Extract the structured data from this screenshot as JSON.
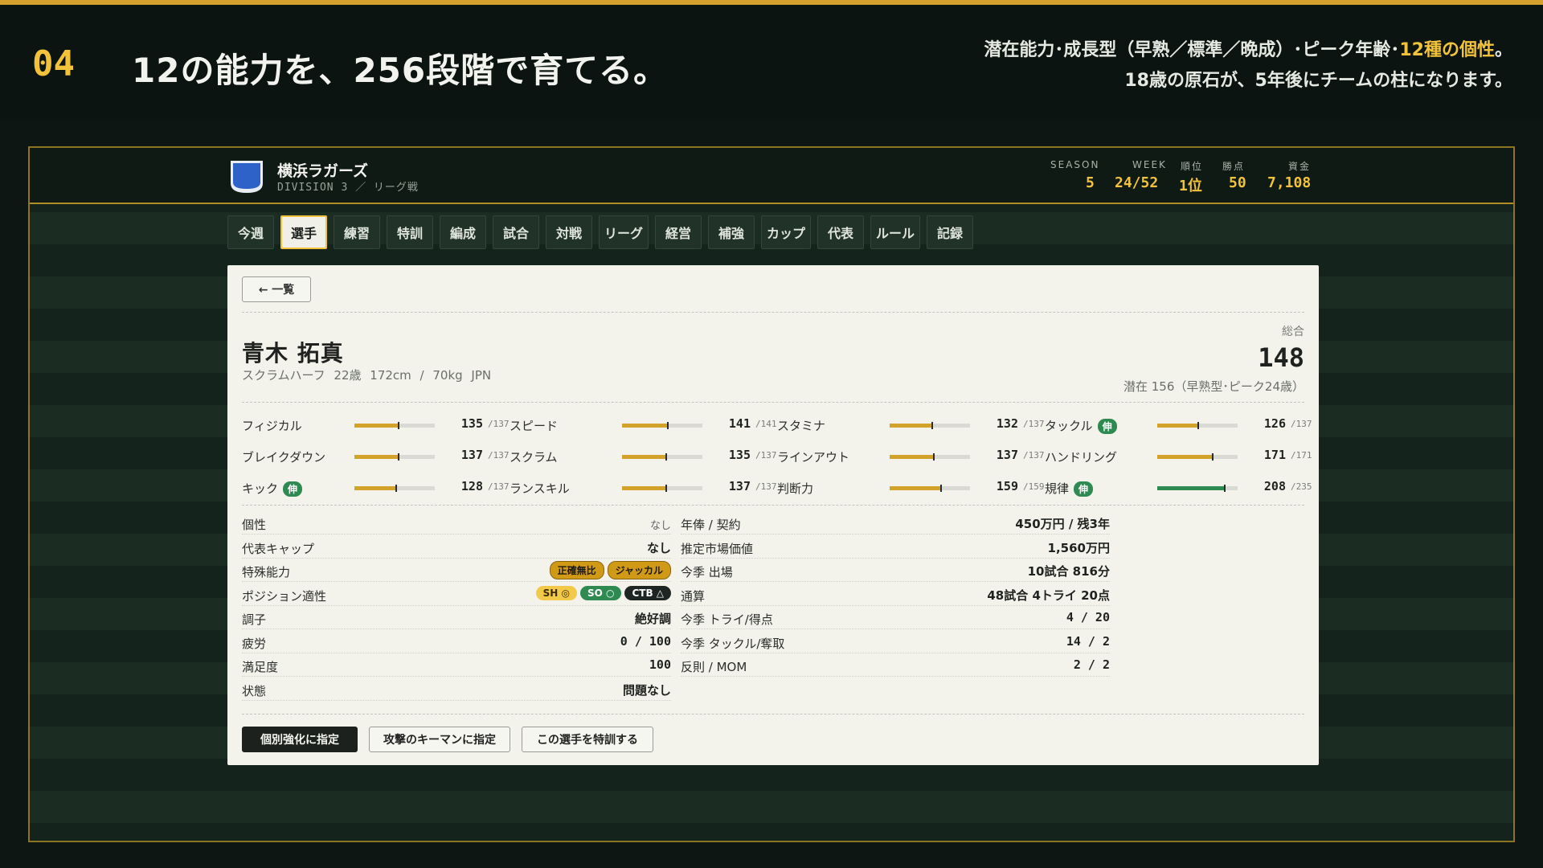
{
  "banner": {
    "number": "04",
    "title": "12の能力を、256段階で育てる。",
    "sub_line1_a": "潜在能力･成長型（早熟／標準／晩成）･ピーク年齢･",
    "sub_line1_hl": "12種の個性",
    "sub_line1_b": "。",
    "sub_line2": "18歳の原石が、5年後にチームの柱になります。"
  },
  "colors": {
    "accent": "#d4a22c",
    "highlight": "#f2c23a",
    "frame_bg": "#1b2d23",
    "grow": "#2f8a52"
  },
  "team": {
    "name": "横浜ラガーズ",
    "division": "DIVISION 3 ／ リーグ戦",
    "emblem": "shield-icon"
  },
  "status": {
    "season_label": "SEASON",
    "season": "5",
    "week_label": "WEEK",
    "week": "24/52",
    "rank_label": "順位",
    "rank": "1位",
    "points_label": "勝点",
    "points": "50",
    "funds_label": "資金",
    "funds": "7,108"
  },
  "tabs": [
    "今週",
    "選手",
    "練習",
    "特訓",
    "編成",
    "試合",
    "対戦",
    "リーグ",
    "経営",
    "補強",
    "カップ",
    "代表",
    "ルール",
    "記録"
  ],
  "active_tab": "選手",
  "player": {
    "back_label": "← 一覧",
    "name": "青木 拓真",
    "meta": "スクラムハーフ 22歳 172cm / 70kg JPN",
    "overall_label": "総合",
    "overall": "148",
    "potential_note": "潜在 156（早熟型･ピーク24歳）"
  },
  "grow_label": "伸",
  "abilities": [
    {
      "label": "フィジカル",
      "value": "135",
      "max": "/137",
      "grow": false
    },
    {
      "label": "スピード",
      "value": "141",
      "max": "/141",
      "grow": false
    },
    {
      "label": "スタミナ",
      "value": "132",
      "max": "/137",
      "grow": false
    },
    {
      "label": "タックル",
      "value": "126",
      "max": "/137",
      "grow": true
    },
    {
      "label": "ブレイクダウン",
      "value": "137",
      "max": "/137",
      "grow": false
    },
    {
      "label": "スクラム",
      "value": "135",
      "max": "/137",
      "grow": false
    },
    {
      "label": "ラインアウト",
      "value": "137",
      "max": "/137",
      "grow": false
    },
    {
      "label": "ハンドリング",
      "value": "171",
      "max": "/171",
      "grow": false
    },
    {
      "label": "キック",
      "value": "128",
      "max": "/137",
      "grow": true
    },
    {
      "label": "ランスキル",
      "value": "137",
      "max": "/137",
      "grow": false
    },
    {
      "label": "判断力",
      "value": "159",
      "max": "/159",
      "grow": false
    },
    {
      "label": "規律",
      "value": "208",
      "max": "/235",
      "grow": true
    }
  ],
  "ability_levels": [
    0.55,
    0.57,
    0.53,
    0.51,
    0.55,
    0.55,
    0.55,
    0.69,
    0.52,
    0.55,
    0.64,
    0.84
  ],
  "left_info": [
    {
      "key": "個性",
      "value": "なし"
    },
    {
      "key": "代表キャップ",
      "value": "なし"
    },
    {
      "key": "特殊能力",
      "badges": [
        "正確無比",
        "ジャッカル"
      ]
    },
    {
      "key": "ポジション適性",
      "badges": [
        "SH ◎",
        "SO ○",
        "CTB △"
      ]
    },
    {
      "key": "調子",
      "value": "絶好調"
    },
    {
      "key": "疲労",
      "value": "0 / 100"
    },
    {
      "key": "満足度",
      "value": "100"
    },
    {
      "key": "状態",
      "value": "問題なし"
    }
  ],
  "right_info": [
    {
      "key": "年俸 / 契約",
      "value": "450万円 / 残3年"
    },
    {
      "key": "推定市場価値",
      "value": "1,560万円"
    },
    {
      "key": "今季 出場",
      "value": "10試合 816分"
    },
    {
      "key": "通算",
      "value": "48試合 4トライ 20点"
    },
    {
      "key": "今季 トライ/得点",
      "value": "4 / 20"
    },
    {
      "key": "今季 タックル/奪取",
      "value": "14 / 2"
    },
    {
      "key": "反則 / MOM",
      "value": "2 / 2"
    }
  ],
  "actions": {
    "focus": "個別強化に指定",
    "keyman": "攻撃のキーマンに指定",
    "train": "この選手を特訓する"
  }
}
